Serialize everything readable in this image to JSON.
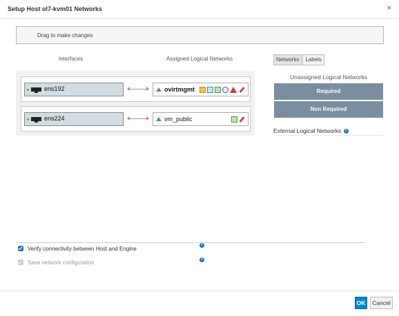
{
  "dialog": {
    "title": "Setup Host ol7-kvm01 Networks",
    "close_label": "×"
  },
  "drag_hint": "Drag to make changes",
  "columns": {
    "interfaces": "Interfaces",
    "assigned": "Assigned Logical Networks"
  },
  "tabs": [
    {
      "label": "Networks",
      "active": true
    },
    {
      "label": "Labels",
      "active": false
    }
  ],
  "unassigned": {
    "title": "Unassigned Logical Networks",
    "sections": [
      "Required",
      "Non Required"
    ]
  },
  "external": {
    "title": "External Logical Networks"
  },
  "rows": [
    {
      "interface": "ens192",
      "network": "ovirtmgmt",
      "network_bold": true,
      "icons": [
        "vm-network-icon",
        "display-network-icon",
        "migration-network-icon",
        "sync-icon",
        "warning-icon",
        "edit-pencil-icon"
      ]
    },
    {
      "interface": "ens224",
      "network": "vm_public",
      "network_bold": false,
      "icons": [
        "vm-network-icon",
        "edit-pencil-icon"
      ]
    }
  ],
  "options": [
    {
      "label": "Verify connectivity between Host and Engine",
      "checked": true,
      "disabled": false
    },
    {
      "label": "Save network configuration",
      "checked": true,
      "disabled": true
    }
  ],
  "buttons": {
    "ok": "OK",
    "cancel": "Cancel"
  },
  "colors": {
    "primary": "#0088ce",
    "unassigned_section": "#7a8ea0",
    "interface_bg": "#d2dde3",
    "status_up": "#3cae3c"
  }
}
